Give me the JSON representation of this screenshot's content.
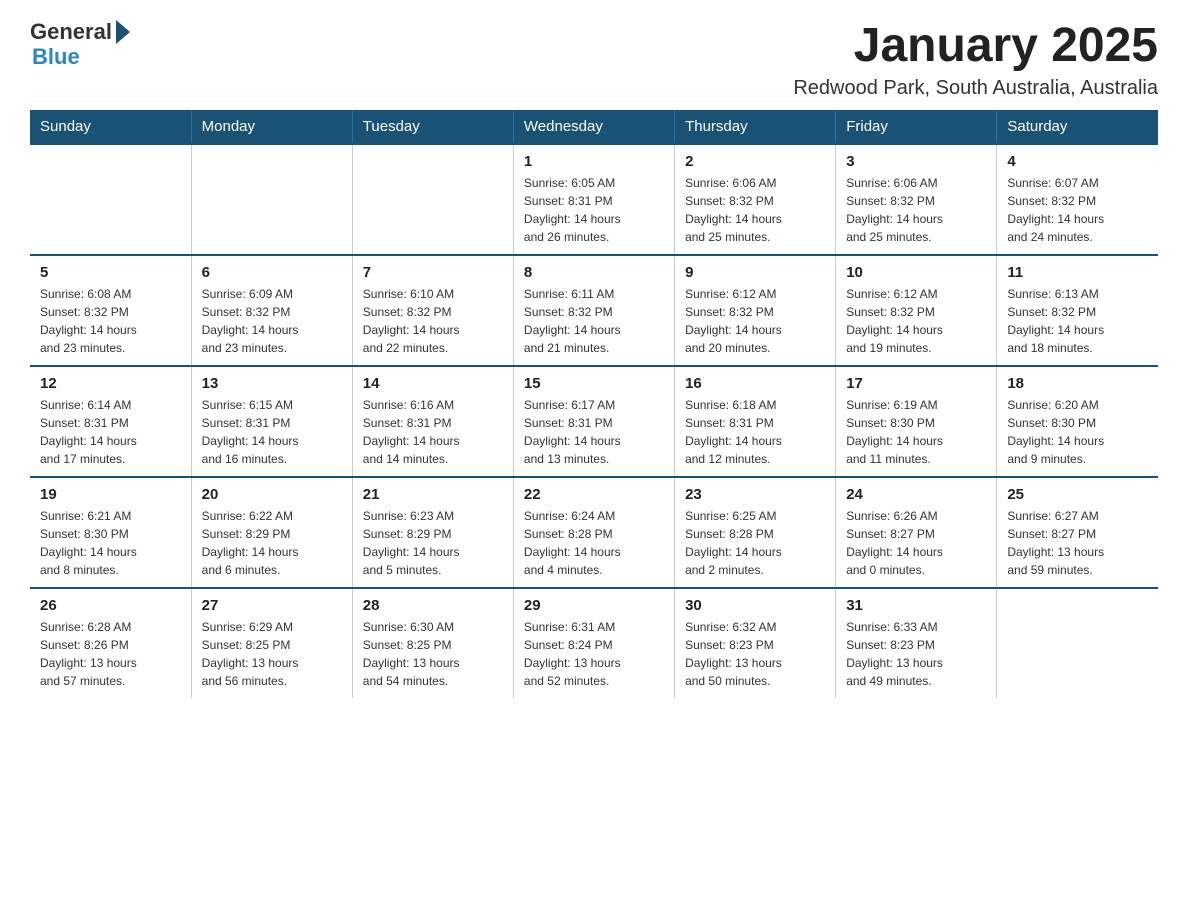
{
  "logo": {
    "general": "General",
    "blue": "Blue"
  },
  "title": "January 2025",
  "subtitle": "Redwood Park, South Australia, Australia",
  "days_of_week": [
    "Sunday",
    "Monday",
    "Tuesday",
    "Wednesday",
    "Thursday",
    "Friday",
    "Saturday"
  ],
  "weeks": [
    [
      {
        "day": "",
        "info": ""
      },
      {
        "day": "",
        "info": ""
      },
      {
        "day": "",
        "info": ""
      },
      {
        "day": "1",
        "info": "Sunrise: 6:05 AM\nSunset: 8:31 PM\nDaylight: 14 hours\nand 26 minutes."
      },
      {
        "day": "2",
        "info": "Sunrise: 6:06 AM\nSunset: 8:32 PM\nDaylight: 14 hours\nand 25 minutes."
      },
      {
        "day": "3",
        "info": "Sunrise: 6:06 AM\nSunset: 8:32 PM\nDaylight: 14 hours\nand 25 minutes."
      },
      {
        "day": "4",
        "info": "Sunrise: 6:07 AM\nSunset: 8:32 PM\nDaylight: 14 hours\nand 24 minutes."
      }
    ],
    [
      {
        "day": "5",
        "info": "Sunrise: 6:08 AM\nSunset: 8:32 PM\nDaylight: 14 hours\nand 23 minutes."
      },
      {
        "day": "6",
        "info": "Sunrise: 6:09 AM\nSunset: 8:32 PM\nDaylight: 14 hours\nand 23 minutes."
      },
      {
        "day": "7",
        "info": "Sunrise: 6:10 AM\nSunset: 8:32 PM\nDaylight: 14 hours\nand 22 minutes."
      },
      {
        "day": "8",
        "info": "Sunrise: 6:11 AM\nSunset: 8:32 PM\nDaylight: 14 hours\nand 21 minutes."
      },
      {
        "day": "9",
        "info": "Sunrise: 6:12 AM\nSunset: 8:32 PM\nDaylight: 14 hours\nand 20 minutes."
      },
      {
        "day": "10",
        "info": "Sunrise: 6:12 AM\nSunset: 8:32 PM\nDaylight: 14 hours\nand 19 minutes."
      },
      {
        "day": "11",
        "info": "Sunrise: 6:13 AM\nSunset: 8:32 PM\nDaylight: 14 hours\nand 18 minutes."
      }
    ],
    [
      {
        "day": "12",
        "info": "Sunrise: 6:14 AM\nSunset: 8:31 PM\nDaylight: 14 hours\nand 17 minutes."
      },
      {
        "day": "13",
        "info": "Sunrise: 6:15 AM\nSunset: 8:31 PM\nDaylight: 14 hours\nand 16 minutes."
      },
      {
        "day": "14",
        "info": "Sunrise: 6:16 AM\nSunset: 8:31 PM\nDaylight: 14 hours\nand 14 minutes."
      },
      {
        "day": "15",
        "info": "Sunrise: 6:17 AM\nSunset: 8:31 PM\nDaylight: 14 hours\nand 13 minutes."
      },
      {
        "day": "16",
        "info": "Sunrise: 6:18 AM\nSunset: 8:31 PM\nDaylight: 14 hours\nand 12 minutes."
      },
      {
        "day": "17",
        "info": "Sunrise: 6:19 AM\nSunset: 8:30 PM\nDaylight: 14 hours\nand 11 minutes."
      },
      {
        "day": "18",
        "info": "Sunrise: 6:20 AM\nSunset: 8:30 PM\nDaylight: 14 hours\nand 9 minutes."
      }
    ],
    [
      {
        "day": "19",
        "info": "Sunrise: 6:21 AM\nSunset: 8:30 PM\nDaylight: 14 hours\nand 8 minutes."
      },
      {
        "day": "20",
        "info": "Sunrise: 6:22 AM\nSunset: 8:29 PM\nDaylight: 14 hours\nand 6 minutes."
      },
      {
        "day": "21",
        "info": "Sunrise: 6:23 AM\nSunset: 8:29 PM\nDaylight: 14 hours\nand 5 minutes."
      },
      {
        "day": "22",
        "info": "Sunrise: 6:24 AM\nSunset: 8:28 PM\nDaylight: 14 hours\nand 4 minutes."
      },
      {
        "day": "23",
        "info": "Sunrise: 6:25 AM\nSunset: 8:28 PM\nDaylight: 14 hours\nand 2 minutes."
      },
      {
        "day": "24",
        "info": "Sunrise: 6:26 AM\nSunset: 8:27 PM\nDaylight: 14 hours\nand 0 minutes."
      },
      {
        "day": "25",
        "info": "Sunrise: 6:27 AM\nSunset: 8:27 PM\nDaylight: 13 hours\nand 59 minutes."
      }
    ],
    [
      {
        "day": "26",
        "info": "Sunrise: 6:28 AM\nSunset: 8:26 PM\nDaylight: 13 hours\nand 57 minutes."
      },
      {
        "day": "27",
        "info": "Sunrise: 6:29 AM\nSunset: 8:25 PM\nDaylight: 13 hours\nand 56 minutes."
      },
      {
        "day": "28",
        "info": "Sunrise: 6:30 AM\nSunset: 8:25 PM\nDaylight: 13 hours\nand 54 minutes."
      },
      {
        "day": "29",
        "info": "Sunrise: 6:31 AM\nSunset: 8:24 PM\nDaylight: 13 hours\nand 52 minutes."
      },
      {
        "day": "30",
        "info": "Sunrise: 6:32 AM\nSunset: 8:23 PM\nDaylight: 13 hours\nand 50 minutes."
      },
      {
        "day": "31",
        "info": "Sunrise: 6:33 AM\nSunset: 8:23 PM\nDaylight: 13 hours\nand 49 minutes."
      },
      {
        "day": "",
        "info": ""
      }
    ]
  ]
}
